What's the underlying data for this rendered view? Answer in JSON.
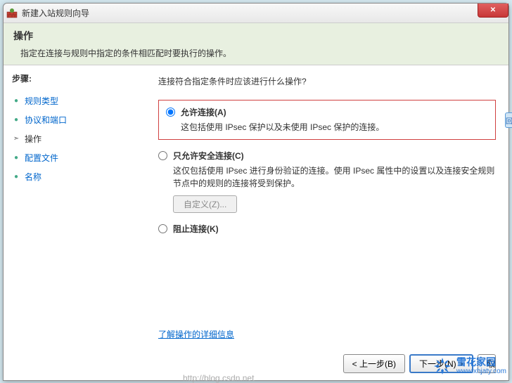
{
  "window": {
    "title": "新建入站规则向导"
  },
  "header": {
    "title": "操作",
    "desc": "指定在连接与规则中指定的条件相匹配时要执行的操作。"
  },
  "sidebar": {
    "title": "步骤:",
    "items": [
      {
        "label": "规则类型",
        "state": "done"
      },
      {
        "label": "协议和端口",
        "state": "done"
      },
      {
        "label": "操作",
        "state": "current"
      },
      {
        "label": "配置文件",
        "state": "todo"
      },
      {
        "label": "名称",
        "state": "todo"
      }
    ]
  },
  "main": {
    "question": "连接符合指定条件时应该进行什么操作?",
    "options": [
      {
        "id": "allow",
        "label": "允许连接(A)",
        "desc": "这包括使用 IPsec 保护以及未使用 IPsec 保护的连接。",
        "checked": true,
        "highlighted": true
      },
      {
        "id": "allow-secure",
        "label": "只允许安全连接(C)",
        "desc": "这仅包括使用 IPsec 进行身份验证的连接。使用 IPsec 属性中的设置以及连接安全规则节点中的规则的连接将受到保护。",
        "checked": false,
        "customize": "自定义(Z)..."
      },
      {
        "id": "block",
        "label": "阻止连接(K)",
        "checked": false
      }
    ],
    "link": "了解操作的详细信息"
  },
  "footer": {
    "back": "< 上一步(B)",
    "next": "下一步(N) >",
    "cancel": "取"
  },
  "watermark": {
    "url_faint": "http://blog.csdn.net",
    "brand": "雪花家园",
    "brand_url": "www.xhjaty.com"
  },
  "edgebox": "回"
}
